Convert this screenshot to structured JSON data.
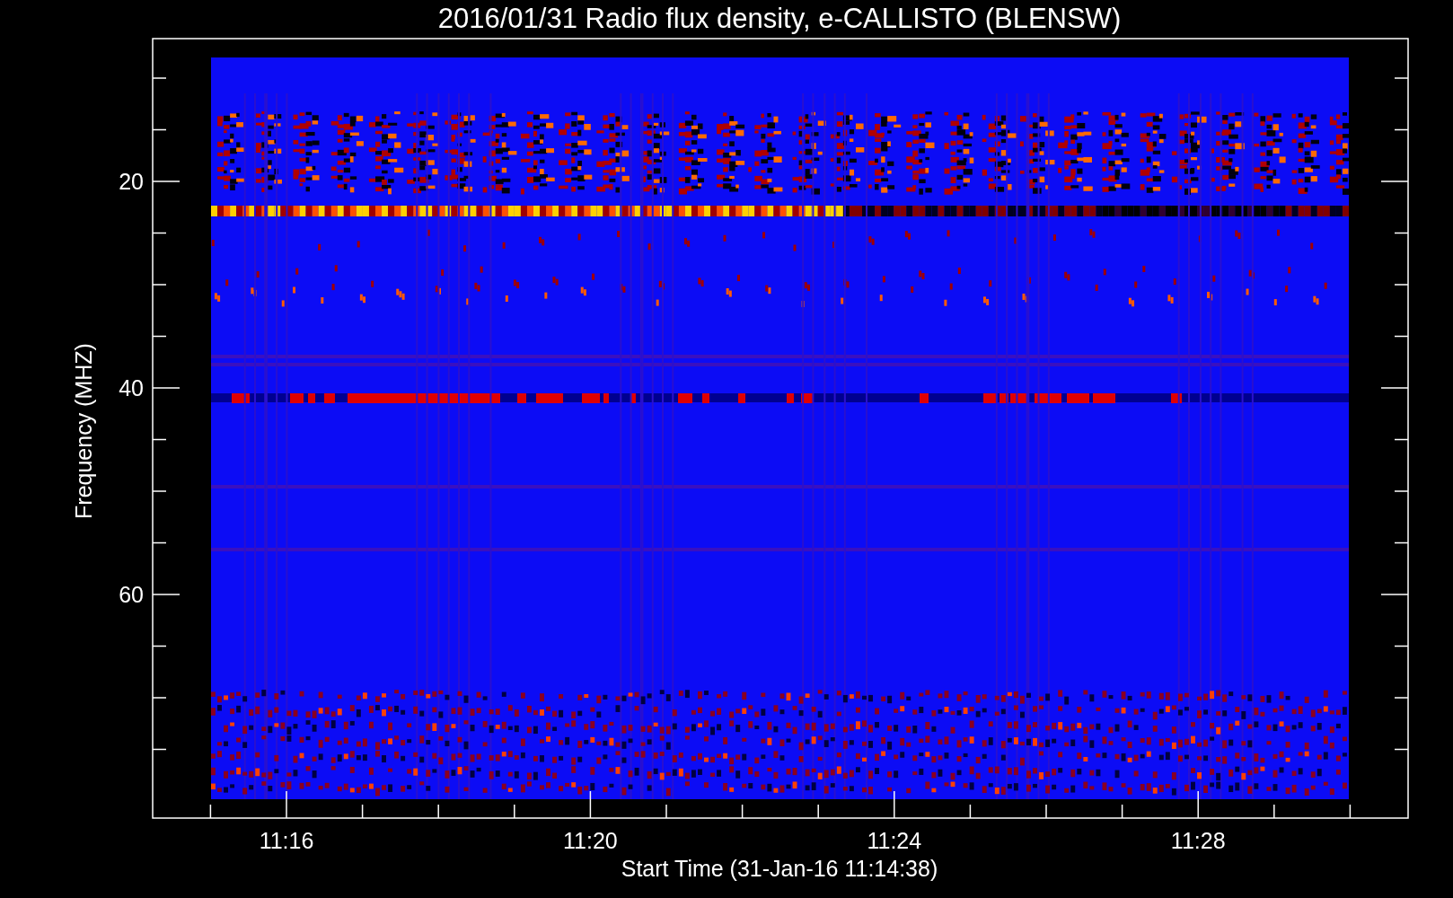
{
  "title": "2016/01/31  Radio flux density, e-CALLISTO (BLENSW)",
  "plot": {
    "xlabel": "Start Time (31-Jan-16 11:14:38)",
    "ylabel": "Frequency (MHZ)",
    "xticks": [
      "11:16",
      "11:20",
      "11:24",
      "11:28"
    ],
    "yticks": [
      "20",
      "40",
      "60"
    ]
  }
}
